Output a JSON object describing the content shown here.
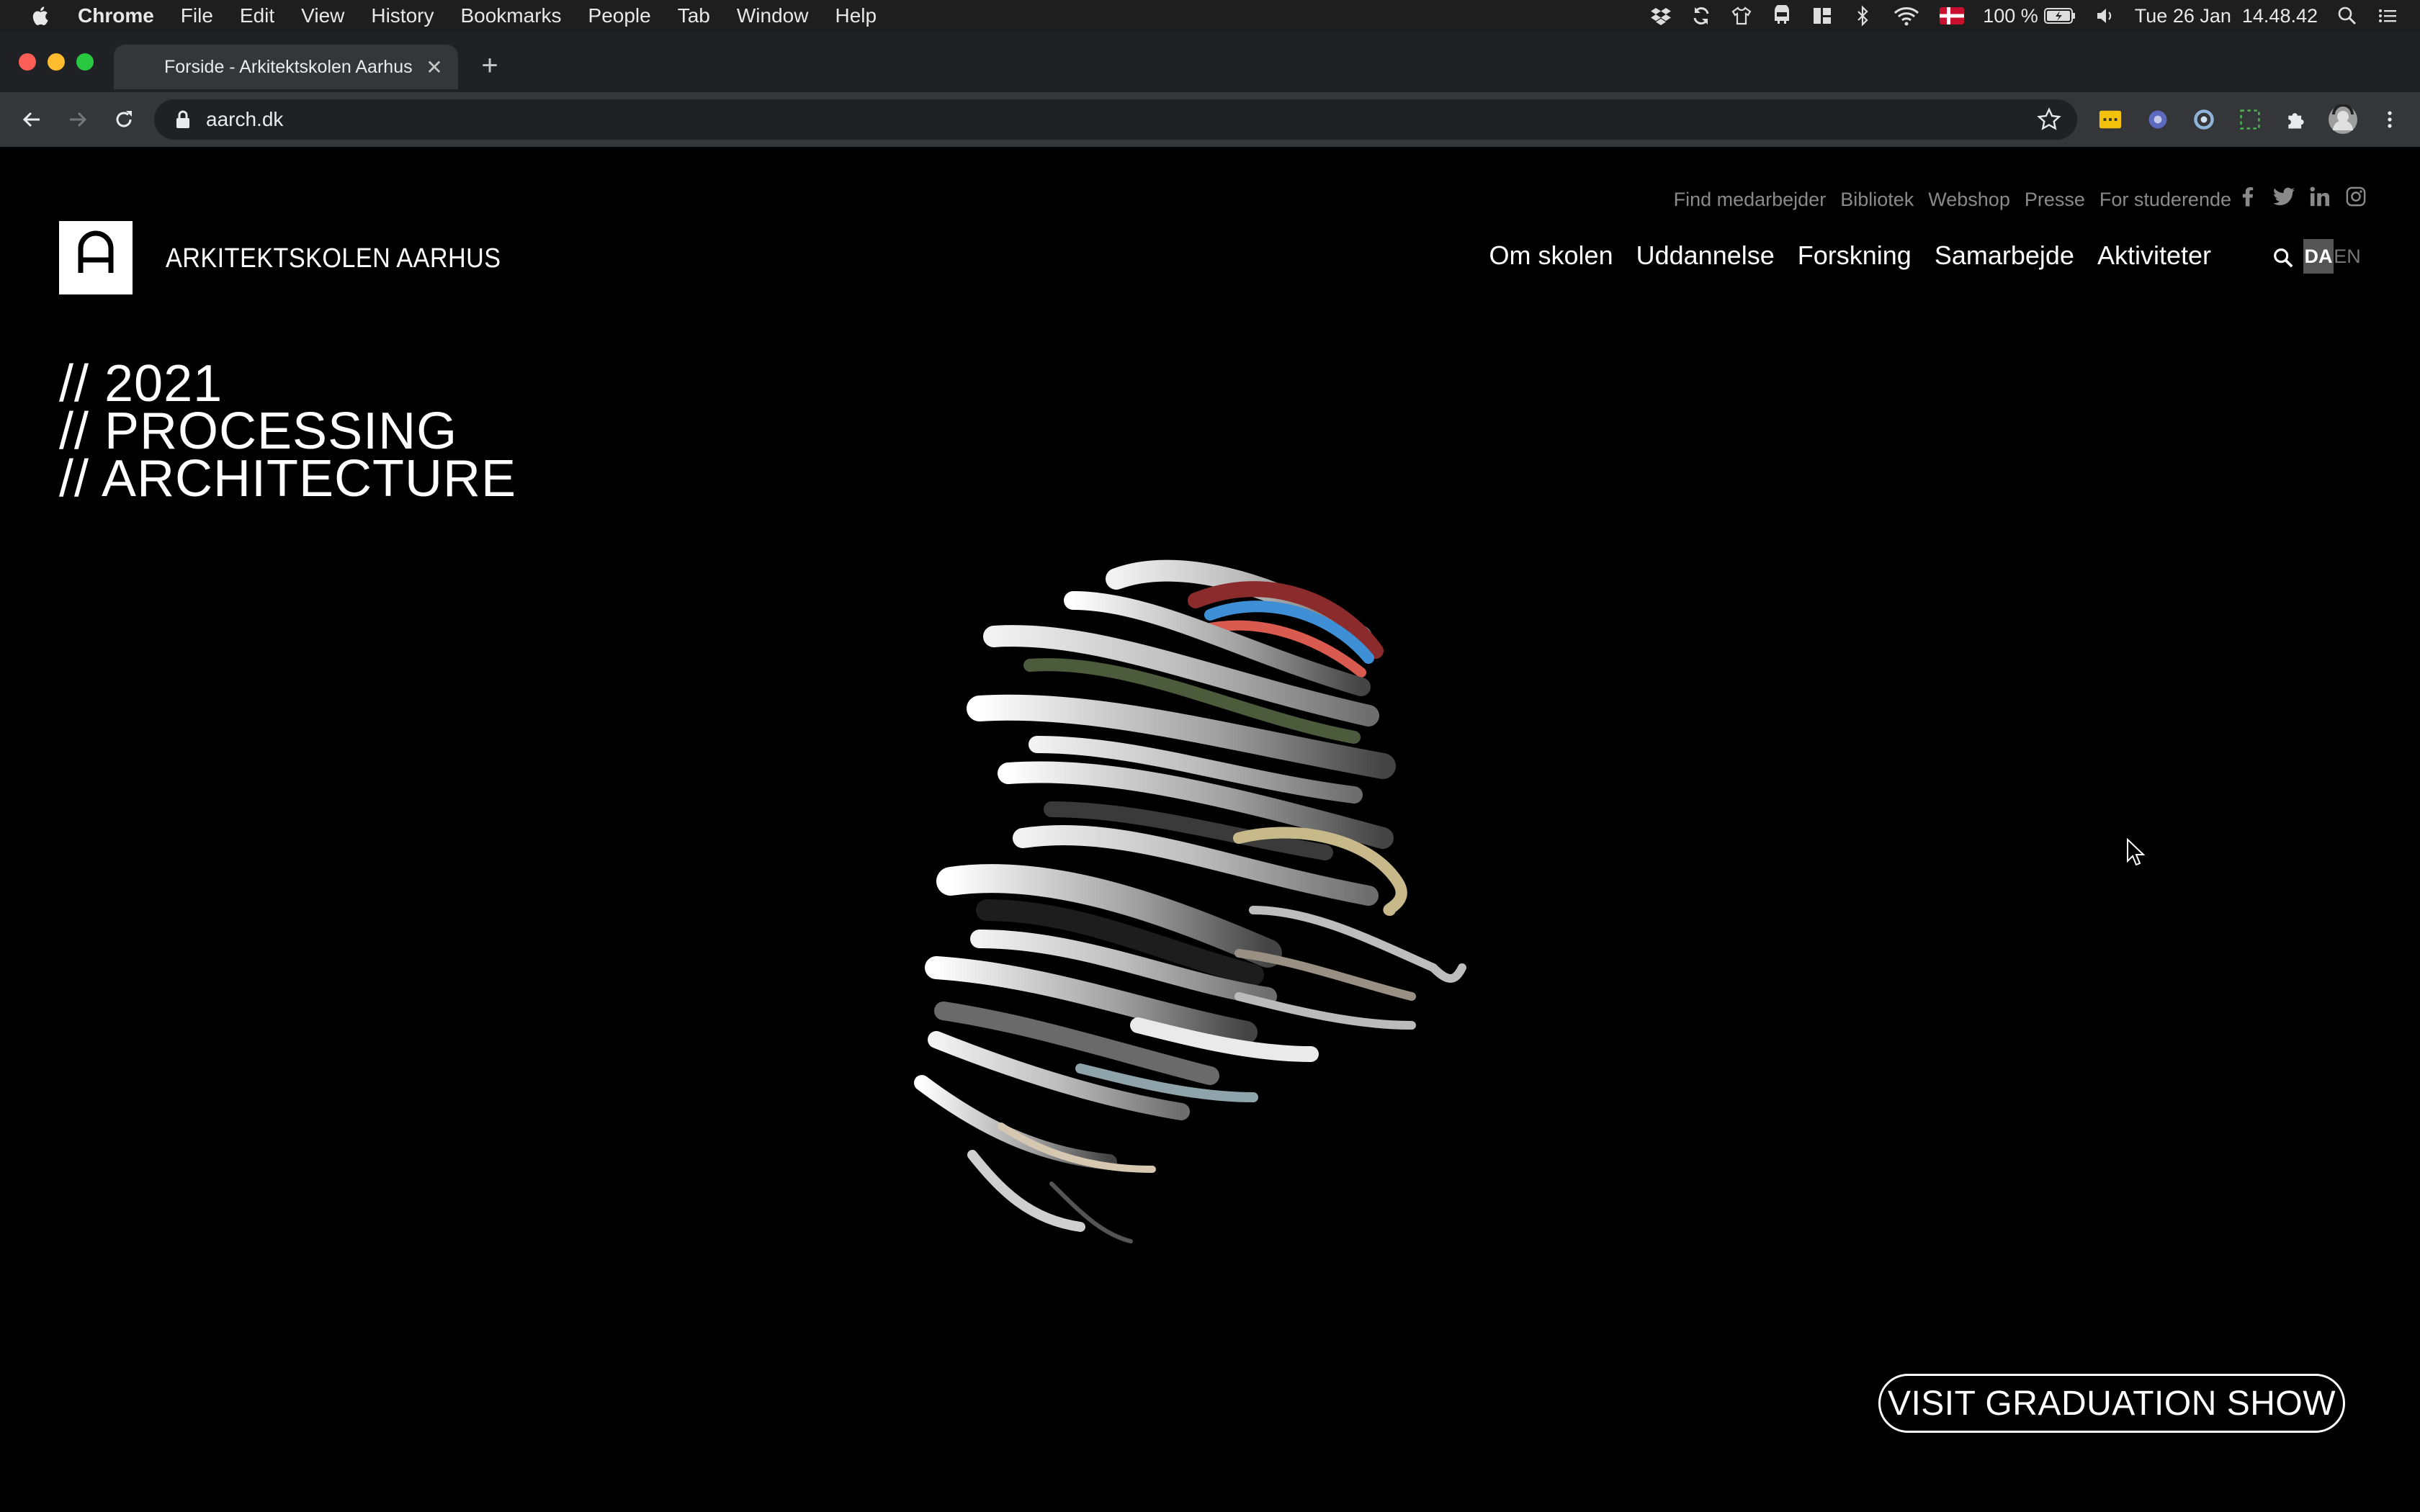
{
  "menubar": {
    "app_name": "Chrome",
    "items": [
      "File",
      "Edit",
      "View",
      "History",
      "Bookmarks",
      "People",
      "Tab",
      "Window",
      "Help"
    ],
    "battery": "100 %",
    "clock": "Tue 26 Jan  14.48.42",
    "status_icons": [
      "dropbox-icon",
      "sync-icon",
      "shirt-icon",
      "drive-icon",
      "layout-icon",
      "bluetooth-icon",
      "wifi-icon",
      "flag-denmark-icon",
      "battery-icon",
      "volume-icon",
      "spotlight-icon",
      "notification-center-icon"
    ]
  },
  "browser": {
    "tab_title": "Forside - Arkitektskolen Aarhus",
    "url": "aarch.dk",
    "extensions": [
      "extension-yellow-icon",
      "extension-blue-icon",
      "extension-ring-icon",
      "extension-dashed-icon",
      "puzzle-icon",
      "profile-avatar"
    ]
  },
  "site": {
    "name": "ARKITEKTSKOLEN AARHUS",
    "utility_nav": [
      "Find medarbejder",
      "Bibliotek",
      "Webshop",
      "Presse",
      "For studerende"
    ],
    "social": [
      "facebook-icon",
      "twitter-icon",
      "linkedin-icon",
      "instagram-icon"
    ],
    "main_nav": [
      "Om skolen",
      "Uddannelse",
      "Forskning",
      "Samarbejde",
      "Aktiviteter"
    ],
    "lang_active": "DA",
    "lang_other": "EN",
    "headline": [
      "// 2021",
      "// PROCESSING",
      "// ARCHITECTURE"
    ],
    "cta": "VISIT GRADUATION SHOW"
  },
  "colors": {
    "background": "#000000",
    "text": "#ffffff",
    "muted": "#8a8a8a",
    "chrome_frame": "#202124",
    "chrome_toolbar": "#35363a"
  }
}
